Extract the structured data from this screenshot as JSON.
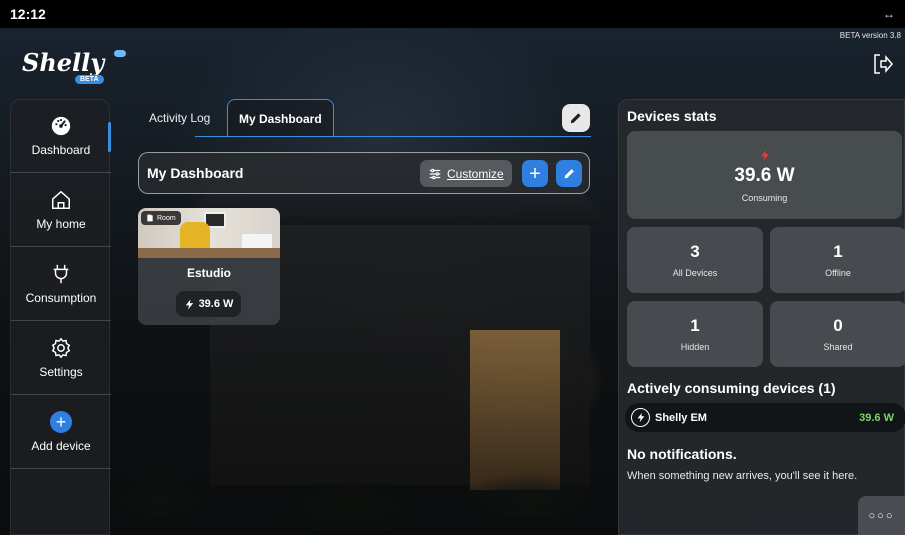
{
  "status_bar": {
    "time": "12:12",
    "arrows": "↔"
  },
  "version": "BETA version 3.8",
  "logo": {
    "word": "Shelly",
    "badge": "BETA"
  },
  "sidebar": {
    "items": [
      {
        "label": "Dashboard",
        "icon": "dashboard-gauge-icon",
        "active": true
      },
      {
        "label": "My home",
        "icon": "home-icon"
      },
      {
        "label": "Consumption",
        "icon": "plug-icon"
      },
      {
        "label": "Settings",
        "icon": "gear-icon"
      },
      {
        "label": "Add device",
        "icon": "plus-circle-icon"
      }
    ]
  },
  "tabs": [
    {
      "label": "Activity Log",
      "active": false
    },
    {
      "label": "My Dashboard",
      "active": true
    }
  ],
  "dashboard": {
    "title": "My Dashboard",
    "customize_label": "Customize",
    "add_label": "+"
  },
  "room_card": {
    "tag": "Room",
    "name": "Estudio",
    "power": "39.6 W"
  },
  "stats": {
    "title": "Devices stats",
    "consuming_value": "39.6 W",
    "consuming_label": "Consuming",
    "all_devices_value": "3",
    "all_devices_label": "All Devices",
    "offline_value": "1",
    "offline_label": "Offline",
    "hidden_value": "1",
    "hidden_label": "Hidden",
    "shared_value": "0",
    "shared_label": "Shared"
  },
  "active_devices": {
    "title": "Actively consuming devices (1)",
    "items": [
      {
        "name": "Shelly EM",
        "value": "39.6 W"
      }
    ]
  },
  "notifications": {
    "title": "No notifications.",
    "text": "When something new arrives, you'll see it here."
  },
  "more_label": "○○○",
  "colors": {
    "accent": "#2f7fe0",
    "consuming_bolt": "#e43b3b",
    "device_value": "#7fd16a"
  }
}
